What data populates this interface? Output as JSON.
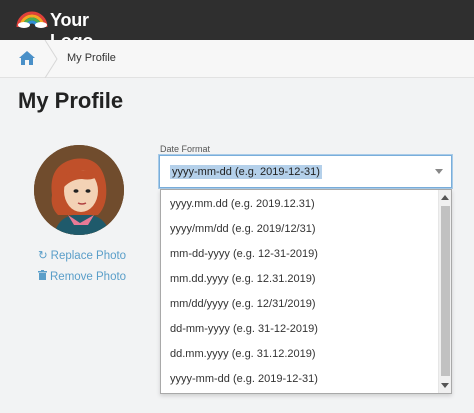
{
  "app": {
    "logo_text": "Your Logo",
    "logo_icon": "rainbow-icon"
  },
  "breadcrumb": {
    "home_icon": "home-icon",
    "current": "My Profile"
  },
  "page": {
    "title": "My Profile"
  },
  "profile": {
    "avatar": "avatar",
    "replace_photo": "Replace Photo",
    "replace_icon": "refresh-icon",
    "remove_photo": "Remove Photo",
    "remove_icon": "trash-icon"
  },
  "date_format": {
    "label": "Date Format",
    "selected": "yyyy-mm-dd (e.g. 2019-12-31)",
    "options": [
      "yyyy-mm-dd (e.g. 2019-12-31)",
      "yyyy.mm.dd (e.g. 2019.12.31)",
      "yyyy/mm/dd (e.g. 2019/12/31)",
      "mm-dd-yyyy (e.g. 12-31-2019)",
      "mm.dd.yyyy (e.g. 12.31.2019)",
      "mm/dd/yyyy (e.g. 12/31/2019)",
      "dd-mm-yyyy (e.g. 31-12-2019)",
      "dd.mm.yyyy (e.g. 31.12.2019)"
    ]
  },
  "colors": {
    "topbar": "#2f2f2f",
    "link": "#5a9ec9",
    "focus": "#79aedb",
    "highlight": "#b4d0ea"
  }
}
